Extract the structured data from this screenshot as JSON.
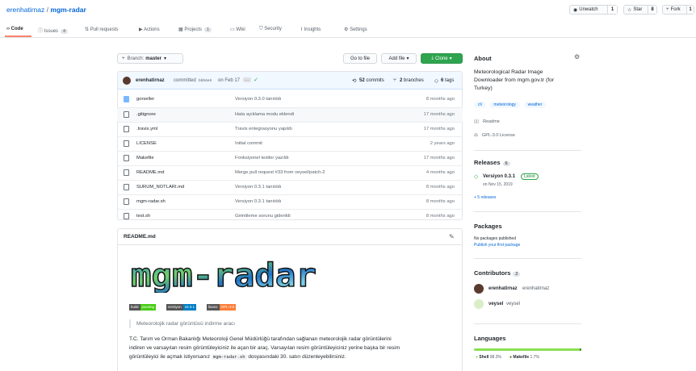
{
  "repo": {
    "owner": "erenhatirnaz",
    "separator": "/",
    "name": "mgm-radar"
  },
  "header_actions": {
    "unwatch": "Unwatch",
    "unwatch_count": "1",
    "star": "Star",
    "star_count": "8",
    "fork": "Fork",
    "fork_count": "1"
  },
  "tabs": [
    {
      "label": "Code",
      "count": ""
    },
    {
      "label": "Issues",
      "count": "4"
    },
    {
      "label": "Pull requests",
      "count": ""
    },
    {
      "label": "Actions",
      "count": ""
    },
    {
      "label": "Projects",
      "count": "1"
    },
    {
      "label": "Wiki",
      "count": ""
    },
    {
      "label": "Security",
      "count": ""
    },
    {
      "label": "Insights",
      "count": ""
    },
    {
      "label": "Settings",
      "count": ""
    }
  ],
  "toolbar": {
    "branch_label": "Branch:",
    "branch": "master",
    "go_to_file": "Go to file",
    "add_file": "Add file",
    "clone": "Clone"
  },
  "commit": {
    "author": "erenhatirnaz",
    "action": "committed",
    "hash": "bbb6e6",
    "date": "on Feb 17",
    "ellipsis": "…",
    "commits_count": "52",
    "commits_label": "commits",
    "branches_count": "2",
    "branches_label": "branches",
    "tags_count": "6",
    "tags_label": "tags"
  },
  "files": [
    {
      "name": "gorseller",
      "type": "dir",
      "message": "Versiyon 0.3.0 tanıtıldı",
      "age": "8 months ago"
    },
    {
      "name": ".gitignore",
      "type": "file",
      "message": "Hata ayıklama modu eklendi",
      "age": "17 months ago"
    },
    {
      "name": ".travis.yml",
      "type": "file",
      "message": "Travis entegrasyonu yapıldı",
      "age": "17 months ago"
    },
    {
      "name": "LICENSE",
      "type": "file",
      "message": "Initial commit",
      "age": "2 years ago"
    },
    {
      "name": "Makefile",
      "type": "file",
      "message": "Fonksiyonel testler yazıldı",
      "age": "17 months ago"
    },
    {
      "name": "README.md",
      "type": "file",
      "message": "Merge pull request #33 from veysel/patch-2",
      "age": "4 months ago"
    },
    {
      "name": "SURUM_NOTLARI.md",
      "type": "file",
      "message": "Versiyon 0.3.1 tanıtıldı",
      "age": "8 months ago"
    },
    {
      "name": "mgm-radar.sh",
      "type": "file",
      "message": "Versiyon 0.3.1 tanıtıldı",
      "age": "8 months ago"
    },
    {
      "name": "test.sh",
      "type": "file",
      "message": "Girintileme sorunu giderildi",
      "age": "8 months ago"
    }
  ],
  "readme": {
    "title": "README.md",
    "logo_text": "mgm-radar",
    "badges": [
      {
        "left": "build",
        "right": "passing",
        "color": "#4c1"
      },
      {
        "left": "versiyon",
        "right": "v0.3.1",
        "color": "#007ec6"
      },
      {
        "left": "lisans",
        "right": "GPL-3.0",
        "color": "#fe7d37"
      }
    ],
    "quote": "Meteorolojik radar görüntüsü indirme aracı",
    "paragraph_1": "T.C. Tarım ve Orman Bakanlığı Meteoroloji Genel Müdürlüğü tarafından sağlanan meteorolojik radar görüntülerini",
    "paragraph_2": "indiren ve varsayılan resim görüntüleyiciniz ile açan bir araç. Varsayılan resim görüntüleyiciniz yerine başka bir resim",
    "paragraph_3_pre": "görüntüleyici ile açmak istiyorsanız",
    "paragraph_3_code": "mgm-radar.sh",
    "paragraph_3_post": "dosyasındaki 30. satırı düzenleyebilirsiniz."
  },
  "about": {
    "title": "About",
    "description_1": "Meteorological Radar Image",
    "description_2": "Downloader from mgm.gov.tr (for",
    "description_3": "Turkey)",
    "topics": [
      "cli",
      "meteorology",
      "weather"
    ],
    "readme": "Readme",
    "license": "GPL-3.0 License"
  },
  "releases": {
    "title": "Releases",
    "count": "6",
    "latest_name": "Versiyon 0.3.1",
    "latest_badge": "Latest",
    "latest_date": "on Nov 15, 2019",
    "more": "+ 5 releases"
  },
  "packages": {
    "title": "Packages",
    "none": "No packages published",
    "publish": "Publish your first package"
  },
  "contributors": {
    "title": "Contributors",
    "count": "2",
    "list": [
      {
        "login": "erenhatirnaz",
        "name": "erenhatirnaz"
      },
      {
        "login": "veysel",
        "name": "veysel"
      }
    ]
  },
  "languages": {
    "title": "Languages",
    "items": [
      {
        "name": "Shell",
        "percent": "98.3%",
        "value": 98.3,
        "color": "#89e051"
      },
      {
        "name": "Makefile",
        "percent": "1.7%",
        "value": 1.7,
        "color": "#427819"
      }
    ]
  }
}
